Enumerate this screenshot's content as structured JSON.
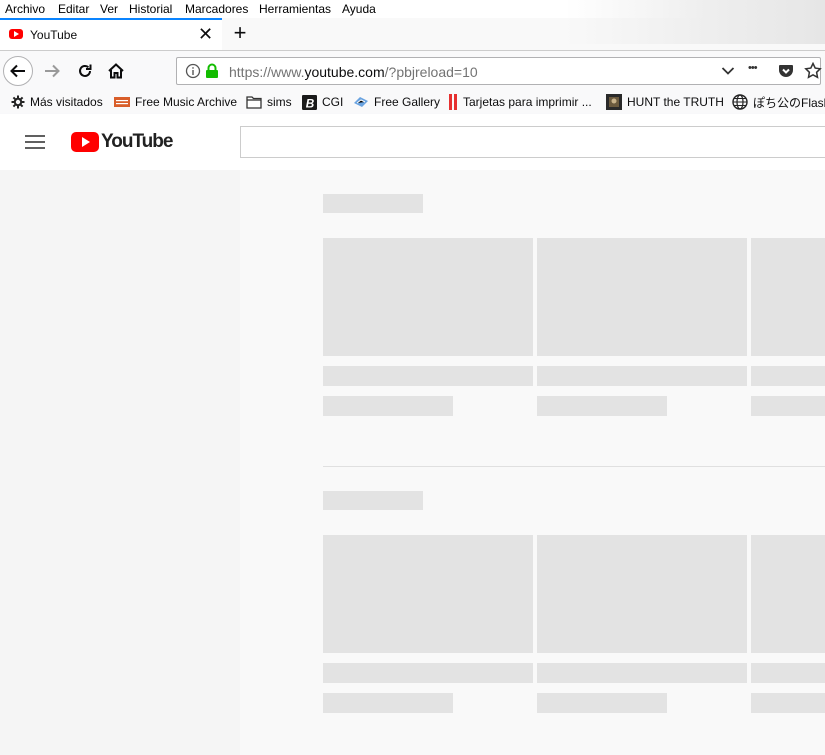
{
  "menubar": {
    "items": [
      "Archivo",
      "Editar",
      "Ver",
      "Historial",
      "Marcadores",
      "Herramientas",
      "Ayuda"
    ]
  },
  "tab": {
    "title": "YouTube",
    "close_glyph": "✕",
    "new_tab_glyph": "+"
  },
  "navbar": {
    "url_prefix": "https://www.",
    "url_host": "youtube.com",
    "url_path": "/?pbjreload=10",
    "more_glyph": "•••"
  },
  "bookmarks": [
    {
      "label": "Más visitados",
      "icon": "gear-icon"
    },
    {
      "label": "Free Music Archive",
      "icon": "fma-icon"
    },
    {
      "label": "sims",
      "icon": "folder-icon"
    },
    {
      "label": "CGI",
      "icon": "b-logo-icon"
    },
    {
      "label": "Free Gallery",
      "icon": "diamond-icon"
    },
    {
      "label": "Tarjetas para imprimir ...",
      "icon": "red-bars-icon"
    },
    {
      "label": "HUNT the TRUTH",
      "icon": "dark-thumbnail-icon"
    },
    {
      "label": "ぽち公のFlash",
      "icon": "globe-icon"
    }
  ],
  "youtube": {
    "logo_text": "YouTube",
    "search_placeholder": ""
  },
  "colors": {
    "accent_tab": "#0a84ff",
    "youtube_red": "#ff0000",
    "placeholder_gray": "#e3e3e3",
    "secure_green": "#12bc00"
  }
}
